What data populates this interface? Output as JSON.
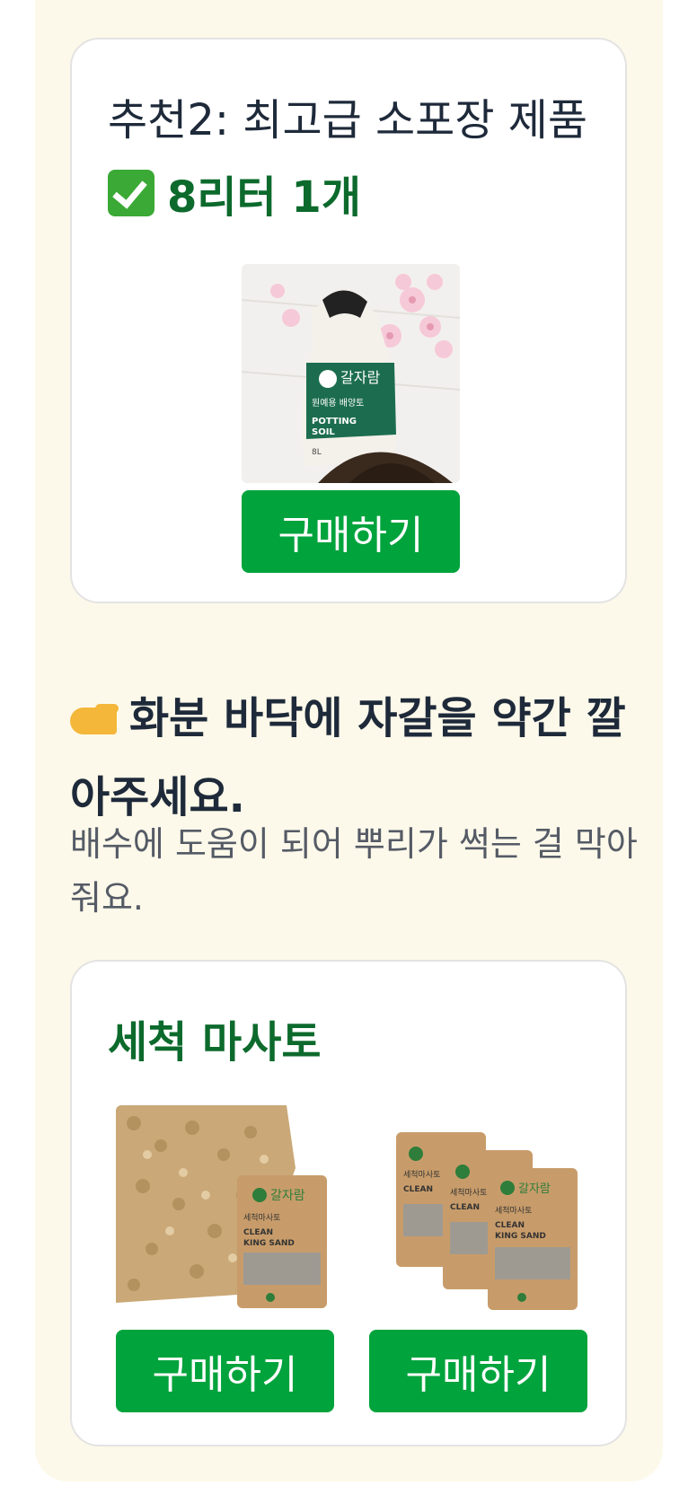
{
  "card1": {
    "title": "추천2: 최고급 소포장 제품",
    "subtitle": "8리터 1개",
    "product_image": {
      "brand_text": "갈자람",
      "label": "원예용 배양토",
      "english": "POTTING SOIL",
      "volume": "8L"
    },
    "button": "구매하기"
  },
  "tip": {
    "heading": "화분 바닥에 자갈을 약간 깔아주세요.",
    "description": "배수에 도움이 되어 뿌리가 썩는 걸 막아줘요."
  },
  "card2": {
    "title": "세척 마사토",
    "products": [
      {
        "brand_text": "갈자람",
        "label": "세척마사토",
        "english": "CLEAN KING SAND",
        "button": "구매하기"
      },
      {
        "brand_text": "갈자람",
        "label": "세척마사토",
        "english": "CLEAN KING SAND",
        "button": "구매하기"
      }
    ]
  },
  "colors": {
    "accent_green": "#00a33c",
    "title_green": "#0c6a2c",
    "panel_bg": "#fdf9ea"
  },
  "icons": [
    "check-mark-icon",
    "pointing-hand-icon"
  ]
}
